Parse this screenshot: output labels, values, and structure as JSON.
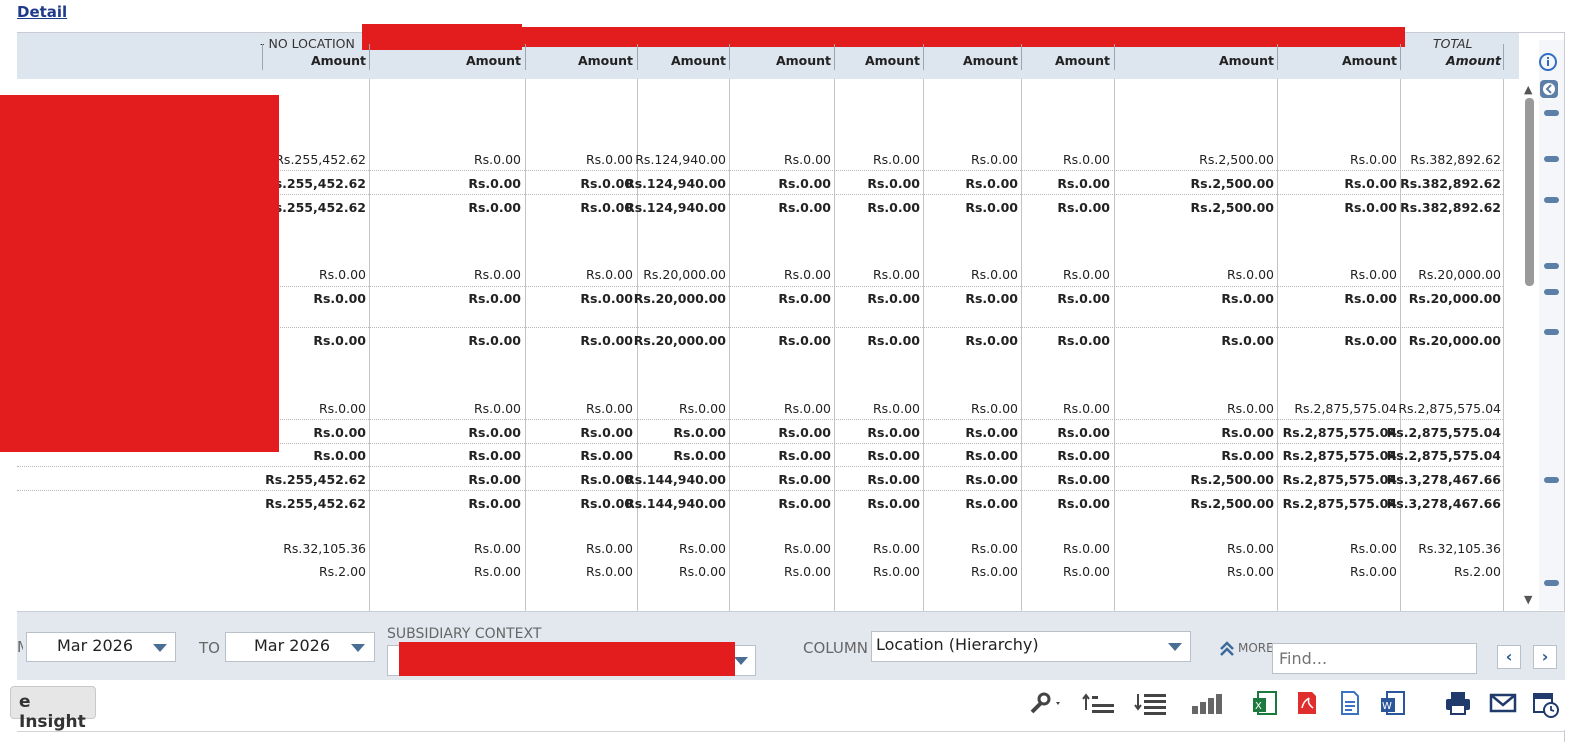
{
  "detail_link": "Detail",
  "header": {
    "no_location": "- NO LOCATION",
    "total": "TOTAL",
    "amount_label": "Amount"
  },
  "rows": [
    [
      "Rs.255,452.62",
      "Rs.0.00",
      "Rs.0.00",
      "Rs.124,940.00",
      "Rs.0.00",
      "Rs.0.00",
      "Rs.0.00",
      "Rs.0.00",
      "Rs.2,500.00",
      "Rs.0.00",
      "Rs.382,892.62"
    ],
    [
      "Rs.255,452.62",
      "Rs.0.00",
      "Rs.0.00",
      "Rs.124,940.00",
      "Rs.0.00",
      "Rs.0.00",
      "Rs.0.00",
      "Rs.0.00",
      "Rs.2,500.00",
      "Rs.0.00",
      "Rs.382,892.62"
    ],
    [
      "Rs.255,452.62",
      "Rs.0.00",
      "Rs.0.00",
      "Rs.124,940.00",
      "Rs.0.00",
      "Rs.0.00",
      "Rs.0.00",
      "Rs.0.00",
      "Rs.2,500.00",
      "Rs.0.00",
      "Rs.382,892.62"
    ],
    [
      "Rs.0.00",
      "Rs.0.00",
      "Rs.0.00",
      "Rs.20,000.00",
      "Rs.0.00",
      "Rs.0.00",
      "Rs.0.00",
      "Rs.0.00",
      "Rs.0.00",
      "Rs.0.00",
      "Rs.20,000.00"
    ],
    [
      "Rs.0.00",
      "Rs.0.00",
      "Rs.0.00",
      "Rs.20,000.00",
      "Rs.0.00",
      "Rs.0.00",
      "Rs.0.00",
      "Rs.0.00",
      "Rs.0.00",
      "Rs.0.00",
      "Rs.20,000.00"
    ],
    [
      "Rs.0.00",
      "Rs.0.00",
      "Rs.0.00",
      "Rs.20,000.00",
      "Rs.0.00",
      "Rs.0.00",
      "Rs.0.00",
      "Rs.0.00",
      "Rs.0.00",
      "Rs.0.00",
      "Rs.20,000.00"
    ],
    [
      "Rs.0.00",
      "Rs.0.00",
      "Rs.0.00",
      "Rs.0.00",
      "Rs.0.00",
      "Rs.0.00",
      "Rs.0.00",
      "Rs.0.00",
      "Rs.0.00",
      "Rs.2,875,575.04",
      "Rs.2,875,575.04"
    ],
    [
      "Rs.0.00",
      "Rs.0.00",
      "Rs.0.00",
      "Rs.0.00",
      "Rs.0.00",
      "Rs.0.00",
      "Rs.0.00",
      "Rs.0.00",
      "Rs.0.00",
      "Rs.2,875,575.04",
      "Rs.2,875,575.04"
    ],
    [
      "Rs.0.00",
      "Rs.0.00",
      "Rs.0.00",
      "Rs.0.00",
      "Rs.0.00",
      "Rs.0.00",
      "Rs.0.00",
      "Rs.0.00",
      "Rs.0.00",
      "Rs.2,875,575.04",
      "Rs.2,875,575.04"
    ],
    [
      "Rs.255,452.62",
      "Rs.0.00",
      "Rs.0.00",
      "Rs.144,940.00",
      "Rs.0.00",
      "Rs.0.00",
      "Rs.0.00",
      "Rs.0.00",
      "Rs.2,500.00",
      "Rs.2,875,575.04",
      "Rs.3,278,467.66"
    ],
    [
      "Rs.255,452.62",
      "Rs.0.00",
      "Rs.0.00",
      "Rs.144,940.00",
      "Rs.0.00",
      "Rs.0.00",
      "Rs.0.00",
      "Rs.0.00",
      "Rs.2,500.00",
      "Rs.2,875,575.04",
      "Rs.3,278,467.66"
    ],
    [
      "Rs.32,105.36",
      "Rs.0.00",
      "Rs.0.00",
      "Rs.0.00",
      "Rs.0.00",
      "Rs.0.00",
      "Rs.0.00",
      "Rs.0.00",
      "Rs.0.00",
      "Rs.0.00",
      "Rs.32,105.36"
    ],
    [
      "Rs.2.00",
      "Rs.0.00",
      "Rs.0.00",
      "Rs.0.00",
      "Rs.0.00",
      "Rs.0.00",
      "Rs.0.00",
      "Rs.0.00",
      "Rs.0.00",
      "Rs.0.00",
      "Rs.2.00"
    ]
  ],
  "filters": {
    "from_label_partial": "M",
    "from_value": "Mar 2026",
    "to_label": "TO",
    "to_value": "Mar 2026",
    "subsidiary_label": "SUBSIDIARY CONTEXT",
    "column_label": "COLUMN",
    "column_value": "Location (Hierarchy)",
    "more_label": "MORE",
    "find_placeholder": "Find..."
  },
  "toolbar": {
    "insight_button_partial": "e Insight"
  },
  "icons": [
    "info-icon",
    "collapse-icon",
    "wrench-icon",
    "expand-rows-icon",
    "collapse-rows-icon",
    "chart-icon",
    "excel-icon",
    "pdf-icon",
    "document-icon",
    "word-icon",
    "print-icon",
    "email-icon",
    "schedule-icon"
  ],
  "colors": {
    "header_bg": "#dde5ef",
    "accent": "#1f3a8a",
    "redaction": "#e31d1d"
  }
}
